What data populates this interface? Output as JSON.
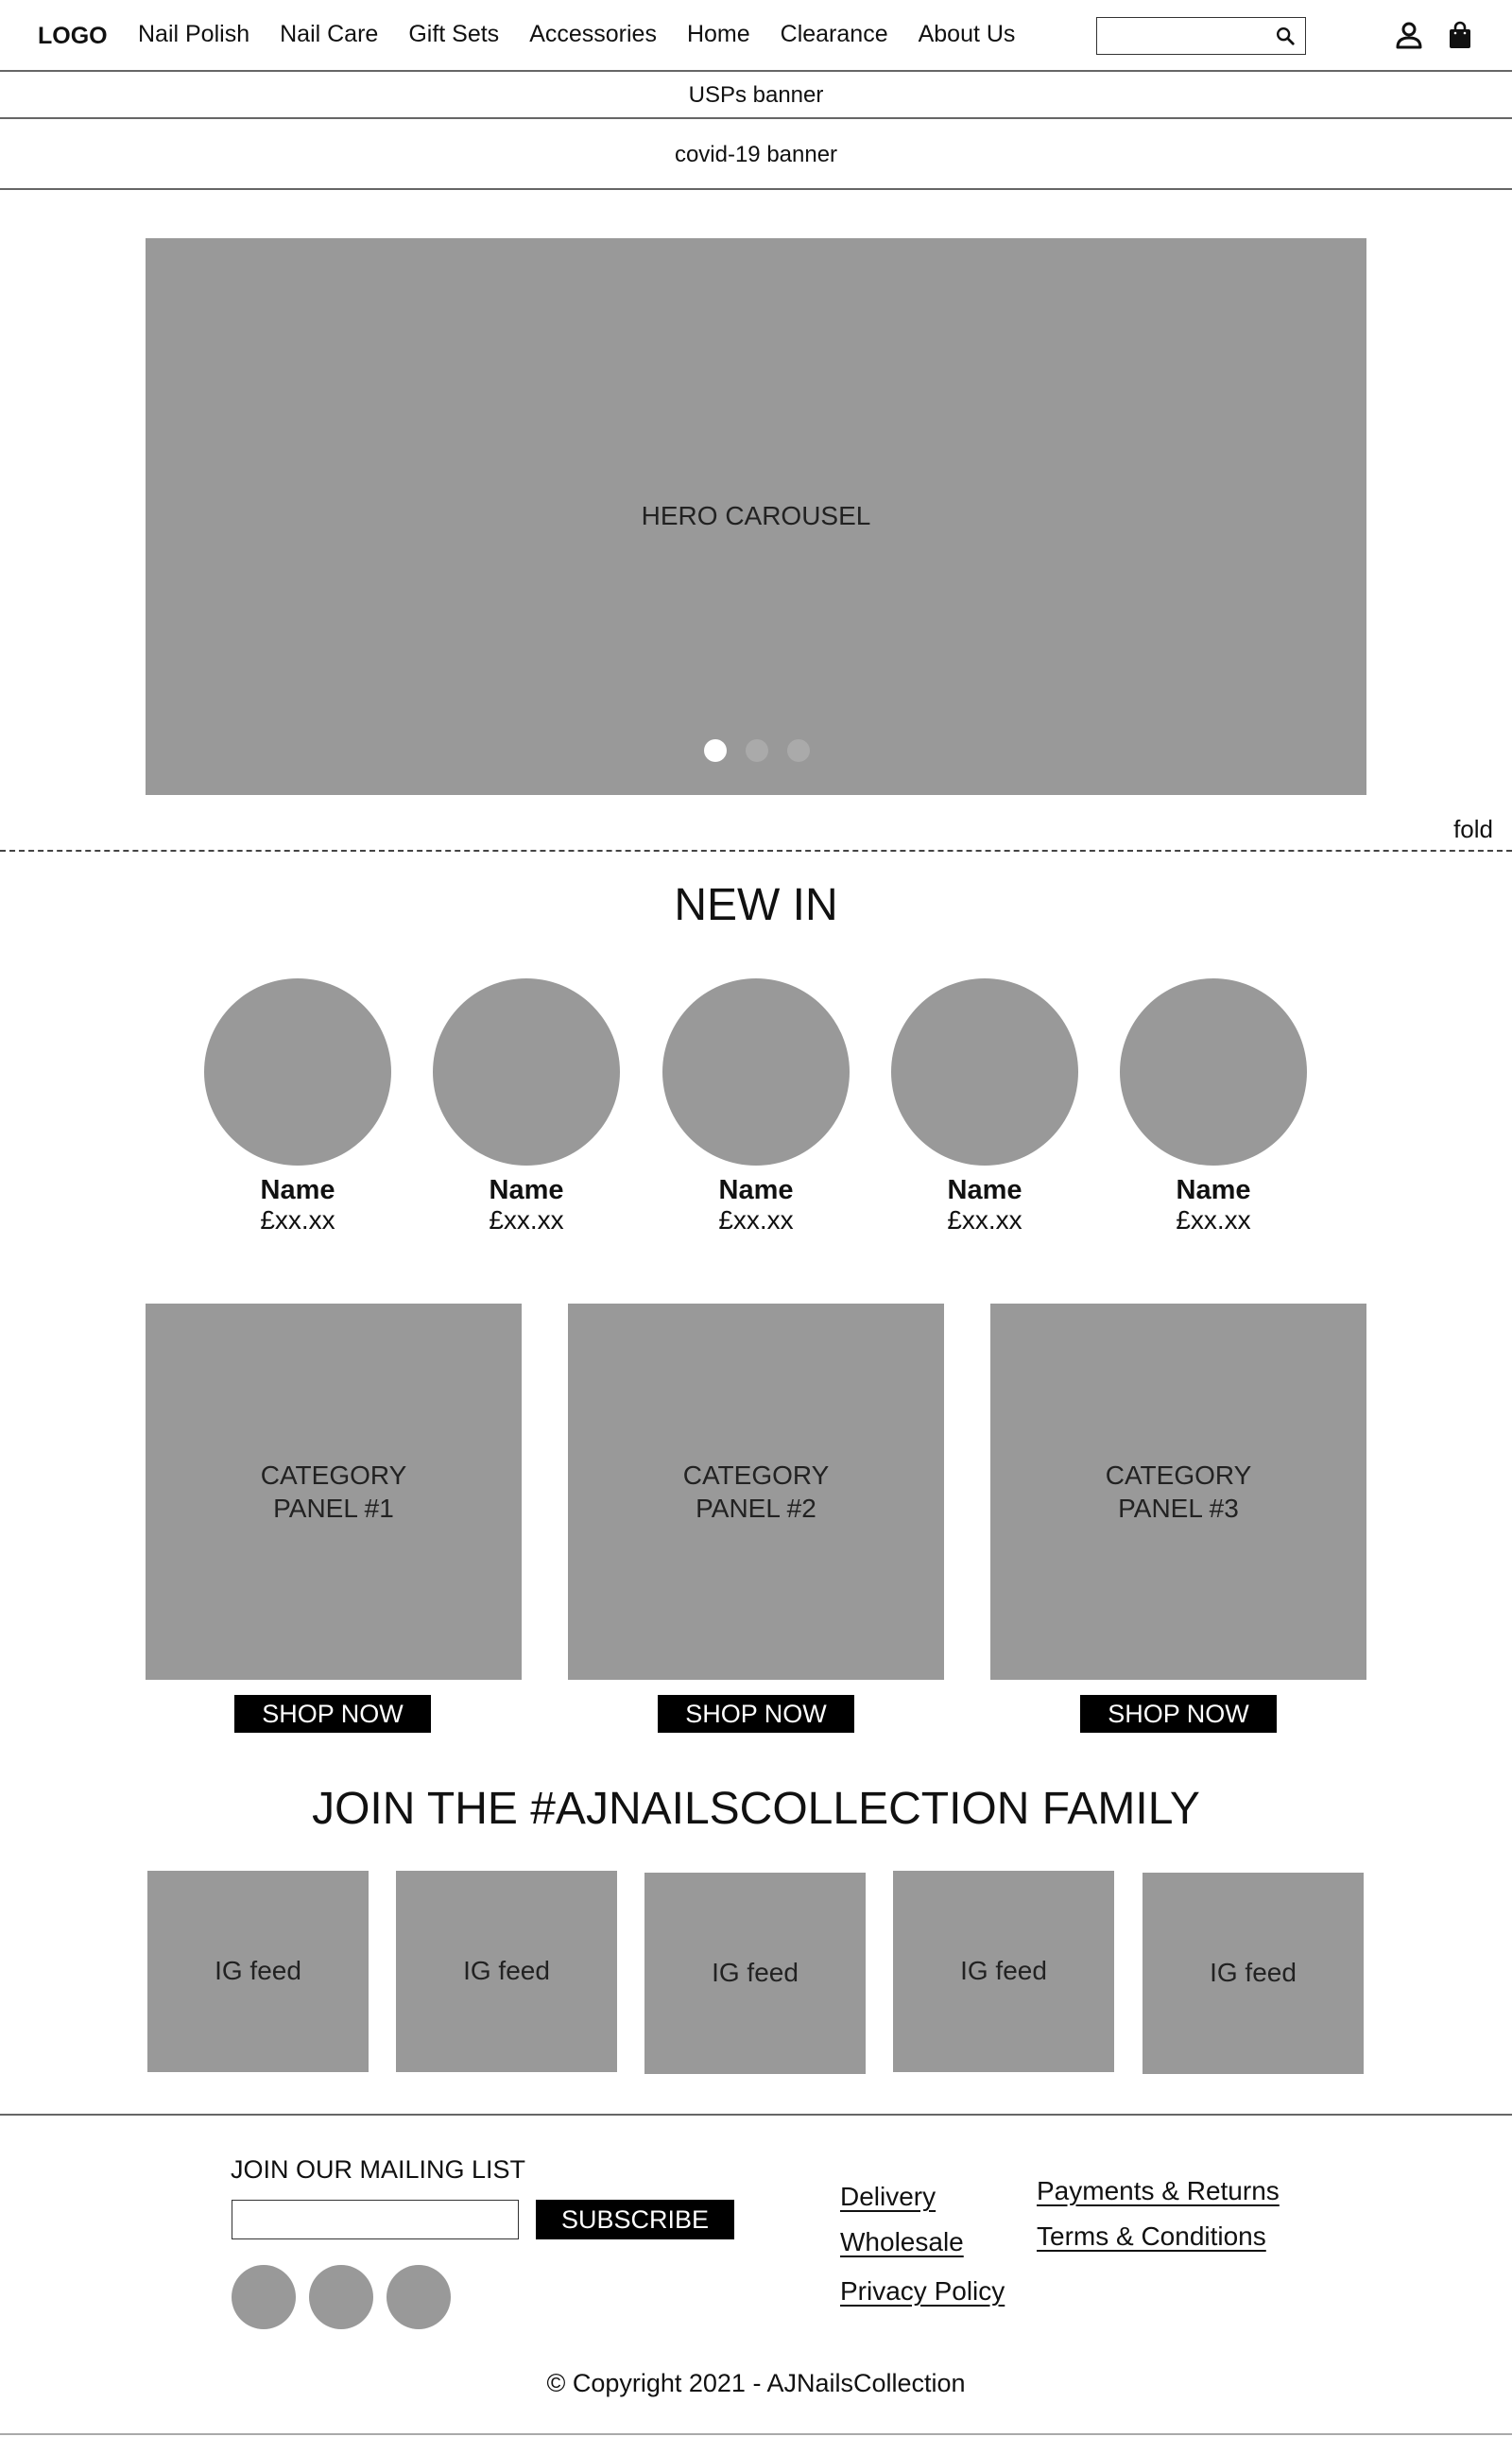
{
  "header": {
    "logo": "LOGO",
    "nav": [
      "Nail Polish",
      "Nail Care",
      "Gift Sets",
      "Accessories",
      "Home",
      "Clearance",
      "About Us"
    ],
    "search_placeholder": "",
    "icons": {
      "search": "search-icon",
      "account": "account-icon",
      "bag": "shopping-bag-icon"
    }
  },
  "banners": {
    "usps": "USPs banner",
    "covid": "covid-19 banner"
  },
  "hero": {
    "label": "HERO CAROUSEL",
    "slides": 3,
    "active_slide": 1
  },
  "fold_label": "fold",
  "new_in": {
    "title": "NEW IN",
    "products": [
      {
        "name": "Name",
        "price": "£xx.xx"
      },
      {
        "name": "Name",
        "price": "£xx.xx"
      },
      {
        "name": "Name",
        "price": "£xx.xx"
      },
      {
        "name": "Name",
        "price": "£xx.xx"
      },
      {
        "name": "Name",
        "price": "£xx.xx"
      }
    ]
  },
  "categories": [
    {
      "line1": "CATEGORY",
      "line2": "PANEL #1",
      "button": "SHOP NOW"
    },
    {
      "line1": "CATEGORY",
      "line2": "PANEL #2",
      "button": "SHOP NOW"
    },
    {
      "line1": "CATEGORY",
      "line2": "PANEL #3",
      "button": "SHOP NOW"
    }
  ],
  "instagram": {
    "title": "JOIN THE #AJNAILSCOLLECTION FAMILY",
    "tiles": [
      "IG feed",
      "IG feed",
      "IG feed",
      "IG feed",
      "IG feed"
    ]
  },
  "footer": {
    "mailing_title": "JOIN OUR MAILING LIST",
    "email_value": "",
    "subscribe": "SUBSCRIBE",
    "social_count": 3,
    "links_col1": [
      "Delivery",
      "Wholesale",
      "Privacy Policy"
    ],
    "links_col2": [
      "Payments & Returns",
      "Terms & Conditions"
    ],
    "copyright": "© Copyright 2021 - AJNailsCollection"
  },
  "colors": {
    "placeholder_gray": "#999999",
    "button_black": "#000000"
  }
}
